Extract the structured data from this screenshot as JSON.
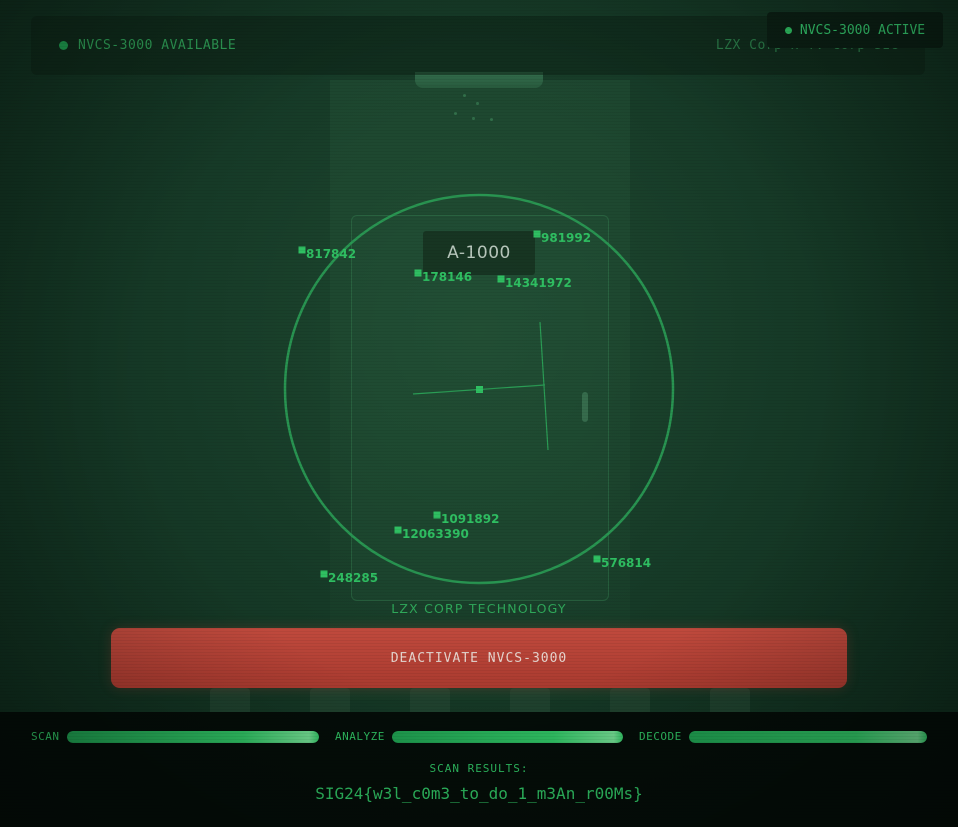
{
  "header": {
    "status_text": "NVCS-3000 AVAILABLE",
    "corp_text": "LZX Corp x Y. Corp SIG"
  },
  "badge": {
    "text": "NVCS-3000 ACTIVE"
  },
  "door": {
    "room_number": "A-1000",
    "caption": "LZX CORP TECHNOLOGY"
  },
  "markers": [
    {
      "label": "817842"
    },
    {
      "label": "981992"
    },
    {
      "label": "178146"
    },
    {
      "label": "14341972"
    },
    {
      "label": "1091892"
    },
    {
      "label": "12063390"
    },
    {
      "label": "576814"
    },
    {
      "label": "248285"
    }
  ],
  "deactivate_button": {
    "label": "DEACTIVATE NVCS-3000"
  },
  "progress": [
    {
      "label": "SCAN",
      "value": 1.0
    },
    {
      "label": "ANALYZE",
      "value": 1.0
    },
    {
      "label": "DECODE",
      "value": 1.0
    }
  ],
  "results": {
    "label": "SCAN RESULTS:",
    "value": "SIG24{w3l_c0m3_to_do_1_m3An_r00Ms}"
  },
  "colors": {
    "accent": "#2fbf62",
    "danger": "#c04a3d",
    "background": "#163a27"
  }
}
